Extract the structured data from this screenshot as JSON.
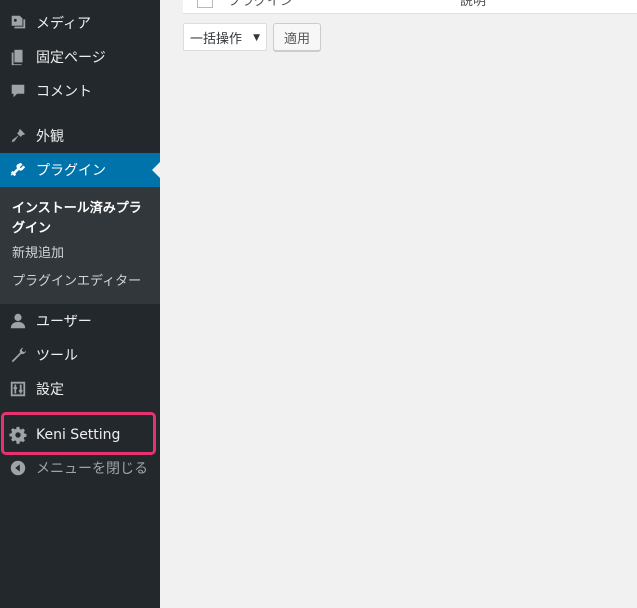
{
  "sidebar": {
    "items": [
      {
        "label": "メディア",
        "icon": "media-icon"
      },
      {
        "label": "固定ページ",
        "icon": "page-icon"
      },
      {
        "label": "コメント",
        "icon": "comment-icon"
      },
      {
        "label": "外観",
        "icon": "appearance-icon"
      },
      {
        "label": "プラグイン",
        "icon": "plugin-icon"
      },
      {
        "label": "ユーザー",
        "icon": "users-icon"
      },
      {
        "label": "ツール",
        "icon": "tools-icon"
      },
      {
        "label": "設定",
        "icon": "settings-icon"
      },
      {
        "label": "Keni Setting",
        "icon": "gear-icon"
      },
      {
        "label": "メニューを閉じる",
        "icon": "collapse-icon"
      }
    ],
    "submenu": [
      {
        "label": "インストール済みプラグイン"
      },
      {
        "label": "新規追加"
      },
      {
        "label": "プラグインエディター"
      }
    ],
    "active_color": "#0073aa",
    "highlight_color": "#e6336f"
  },
  "main": {
    "top_row_partial": "プラグイン",
    "top_row_partial2": "説明",
    "bulk_action": {
      "selected": "一括操作"
    },
    "apply_label": "適用"
  }
}
